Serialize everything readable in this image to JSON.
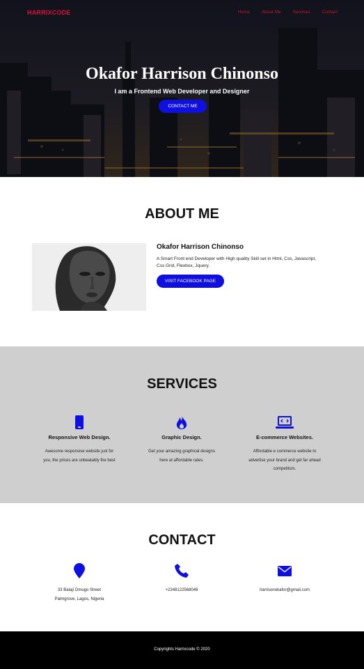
{
  "nav": {
    "brand": "HARRIXCODE",
    "links": [
      "Home",
      "About Me",
      "Services",
      "Contact"
    ]
  },
  "hero": {
    "title": "Okafor Harrison Chinonso",
    "subtitle": "I am a Frontend Web Developer and Designer",
    "button_label": "CONTACT ME"
  },
  "about": {
    "title": "ABOUT ME",
    "name": "Okafor Harrison Chinonso",
    "text": "A Smart Front end Developer with High quality Skill set in Html, Css, Javascript, Css Grid, Flexbox, Jquery.",
    "button_label": "VISIT FACEBOOK PAGE"
  },
  "services": {
    "title": "SERVICES",
    "items": [
      {
        "icon": "mobile-icon",
        "title": "Responsive Web Design.",
        "desc_lines": [
          "Awesome responsive website just for",
          "you, the prices are unbeatably the best"
        ]
      },
      {
        "icon": "fire-icon",
        "title": "Graphic Design.",
        "desc_lines": [
          "Get your amazing graphical designs",
          "here at affordable rates."
        ]
      },
      {
        "icon": "laptop-code-icon",
        "title": "E-commerce Websites.",
        "desc_lines": [
          "Affordable e commerce website to",
          "advertise your brand and get far ahead",
          "competitors."
        ]
      }
    ]
  },
  "contact": {
    "title": "CONTACT",
    "items": [
      {
        "icon": "map-marker-icon",
        "lines": [
          "33 Balaji Omugo Street",
          "Palmgrove, Lagos, Nigeria"
        ]
      },
      {
        "icon": "phone-icon",
        "lines": [
          "+2348122568048"
        ]
      },
      {
        "icon": "envelope-icon",
        "lines": [
          "harrisonokafor@gmail.com"
        ]
      }
    ]
  },
  "footer": {
    "text": "Copyrights Harrixcode © 2020"
  },
  "colors": {
    "brand": "#d7143b",
    "accent_blue": "#0f0fe0",
    "services_bg": "#cfcfcf",
    "footer_bg": "#000000"
  }
}
